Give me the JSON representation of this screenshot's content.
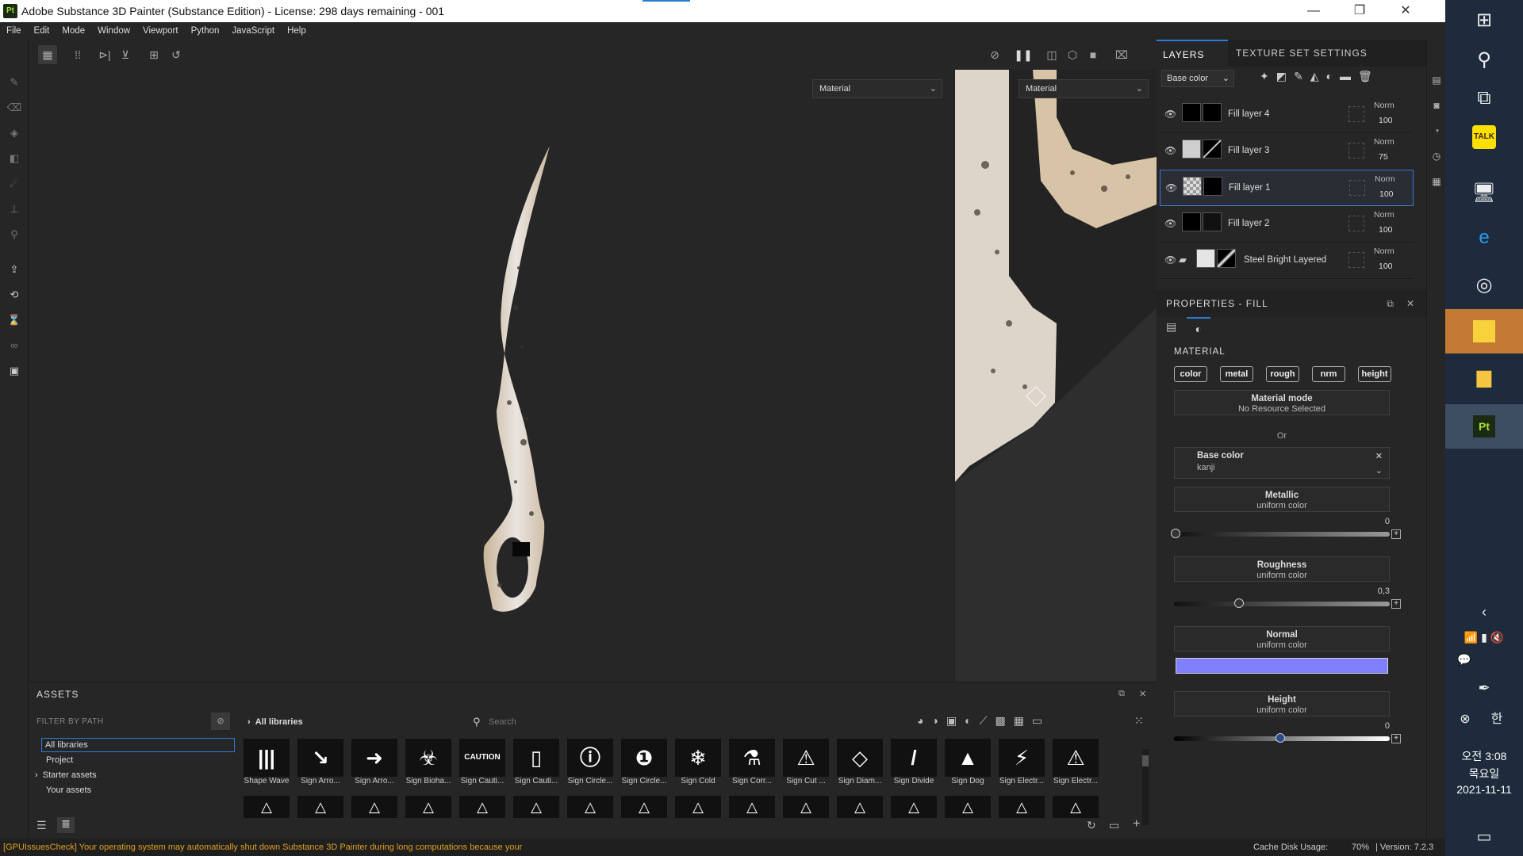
{
  "window": {
    "title": "Adobe Substance 3D Painter (Substance Edition) - License: 298 days remaining - 001",
    "app_icon": "Pt"
  },
  "menu": [
    "File",
    "Edit",
    "Mode",
    "Window",
    "Viewport",
    "Python",
    "JavaScript",
    "Help"
  ],
  "viewport": {
    "left_mode": "Material",
    "right_mode": "Material"
  },
  "layers_panel": {
    "tabs": [
      "LAYERS",
      "TEXTURE SET SETTINGS"
    ],
    "channel": "Base color",
    "layers": [
      {
        "name": "Fill layer 4",
        "blend": "Norm",
        "opacity": "100"
      },
      {
        "name": "Fill layer 3",
        "blend": "Norm",
        "opacity": "75"
      },
      {
        "name": "Fill layer 1",
        "blend": "Norm",
        "opacity": "100",
        "selected": true
      },
      {
        "name": "Fill layer 2",
        "blend": "Norm",
        "opacity": "100"
      },
      {
        "name": "Steel Bright Layered",
        "blend": "Norm",
        "opacity": "100",
        "folder": true
      }
    ]
  },
  "properties": {
    "title": "PROPERTIES - FILL",
    "section": "MATERIAL",
    "channels": [
      "color",
      "metal",
      "rough",
      "nrm",
      "height"
    ],
    "material_mode": {
      "label": "Material mode",
      "value": "No Resource Selected"
    },
    "or_label": "Or",
    "base_color": {
      "label": "Base color",
      "value": "kanji"
    },
    "metallic": {
      "label": "Metallic",
      "sub": "uniform color",
      "value": "0"
    },
    "roughness": {
      "label": "Roughness",
      "sub": "uniform color",
      "value": "0,3"
    },
    "normal": {
      "label": "Normal",
      "sub": "uniform color",
      "color": "#8080ff"
    },
    "height": {
      "label": "Height",
      "sub": "uniform color",
      "value": "0"
    }
  },
  "assets": {
    "title": "ASSETS",
    "filter_label": "FILTER BY PATH",
    "breadcrumb": "All libraries",
    "search_placeholder": "Search",
    "tree": [
      "All libraries",
      "Project",
      "Starter assets",
      "Your assets"
    ],
    "items": [
      {
        "label": "Shape Wave",
        "glyph": "|||"
      },
      {
        "label": "Sign Arro...",
        "glyph": "↘"
      },
      {
        "label": "Sign Arro...",
        "glyph": "➜"
      },
      {
        "label": "Sign Bioha...",
        "glyph": "☣"
      },
      {
        "label": "Sign Cauti...",
        "glyph": "CAUTION"
      },
      {
        "label": "Sign Cauti...",
        "glyph": "▯"
      },
      {
        "label": "Sign Circle...",
        "glyph": "ⓘ"
      },
      {
        "label": "Sign Circle...",
        "glyph": "❶"
      },
      {
        "label": "Sign Cold",
        "glyph": "❄"
      },
      {
        "label": "Sign Corr...",
        "glyph": "⚗"
      },
      {
        "label": "Sign Cut ...",
        "glyph": "⚠"
      },
      {
        "label": "Sign Diam...",
        "glyph": "◇"
      },
      {
        "label": "Sign Divide",
        "glyph": "/"
      },
      {
        "label": "Sign Dog",
        "glyph": "▲"
      },
      {
        "label": "Sign Electr...",
        "glyph": "⚡"
      },
      {
        "label": "Sign Electr...",
        "glyph": "⚠"
      }
    ]
  },
  "status": {
    "warning": "[GPUIssuesCheck] Your operating system may automatically shut down Substance 3D Painter during long computations because your",
    "cache_label": "Cache Disk Usage:",
    "cache_value": "70%",
    "version": "| Version: 7.2.3"
  },
  "taskbar": {
    "time": "오전 3:08",
    "day": "목요일",
    "date": "2021-11-11"
  }
}
